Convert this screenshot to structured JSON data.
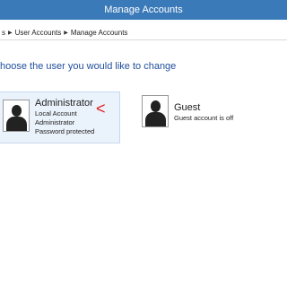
{
  "window": {
    "title": "Manage Accounts"
  },
  "breadcrumb": {
    "items": [
      "s",
      "User Accounts",
      "Manage Accounts"
    ]
  },
  "main": {
    "heading": "hoose the user you would like to change",
    "accounts": [
      {
        "name": "Administrator",
        "details": [
          "Local Account",
          "Administrator",
          "Password protected"
        ],
        "selected": true
      },
      {
        "name": "Guest",
        "details": [
          "Guest account is off"
        ],
        "selected": false
      }
    ]
  },
  "annotation": {
    "text": "<",
    "color": "#e02020"
  },
  "colors": {
    "titlebar": "#3b7ab8",
    "heading": "#1f4e9c",
    "selection": "#eaf2fb"
  }
}
